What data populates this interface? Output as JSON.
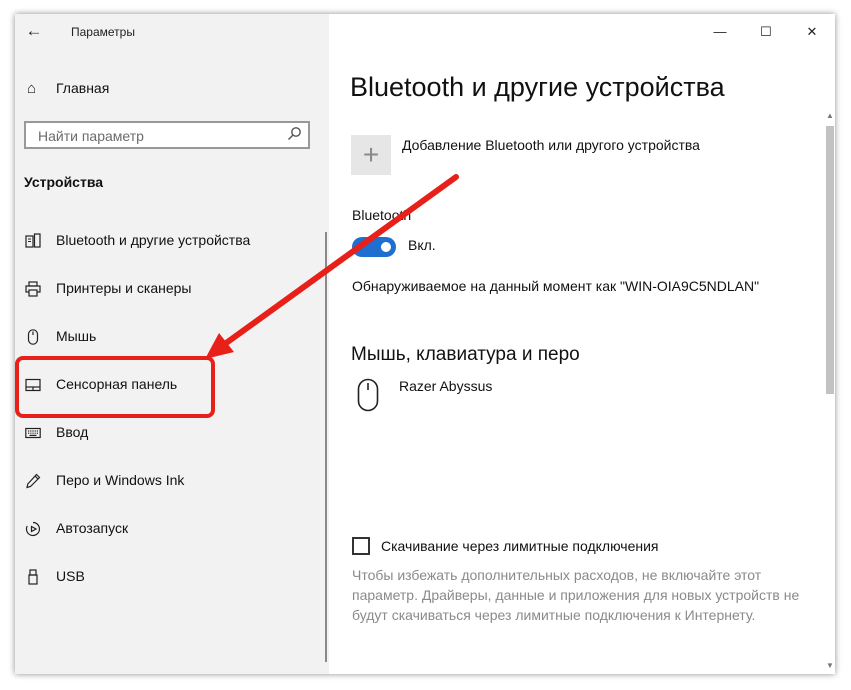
{
  "window": {
    "title": "Параметры"
  },
  "controls": {
    "back_icon": "arrow-left-icon",
    "minimize": "—",
    "maximize": "☐",
    "close": "✕"
  },
  "sidebar": {
    "home_label": "Главная",
    "search_placeholder": "Найти параметр",
    "section_title": "Устройства",
    "items": [
      {
        "label": "Bluetooth и другие устройства",
        "icon": "bluetooth-devices-icon"
      },
      {
        "label": "Принтеры и сканеры",
        "icon": "printer-icon"
      },
      {
        "label": "Мышь",
        "icon": "mouse-icon"
      },
      {
        "label": "Сенсорная панель",
        "icon": "touchpad-icon"
      },
      {
        "label": "Ввод",
        "icon": "keyboard-icon"
      },
      {
        "label": "Перо и Windows Ink",
        "icon": "pen-icon"
      },
      {
        "label": "Автозапуск",
        "icon": "autoplay-icon"
      },
      {
        "label": "USB",
        "icon": "usb-icon"
      }
    ]
  },
  "main": {
    "title": "Bluetooth и другие устройства",
    "add_label": "Добавление Bluetooth или другого устройства",
    "bluetooth_label": "Bluetooth",
    "bluetooth_state": "Вкл.",
    "discoverable_text": "Обнаруживаемое на данный момент как \"WIN-OIA9C5NDLAN\"",
    "subheader": "Мышь, клавиатура и перо",
    "devices": [
      {
        "name": "Razer Abyssus",
        "icon": "mouse-icon"
      }
    ],
    "metered_label": "Скачивание через лимитные подключения",
    "metered_checked": false,
    "metered_note": "Чтобы избежать дополнительных расходов, не включайте этот параметр. Драйверы, данные и приложения для новых устройств не будут скачиваться через лимитные подключения к Интернету."
  },
  "colors": {
    "accent": "#1e6fd0",
    "annotation": "#e8201a",
    "sidebar_bg": "#f2f2f2"
  }
}
